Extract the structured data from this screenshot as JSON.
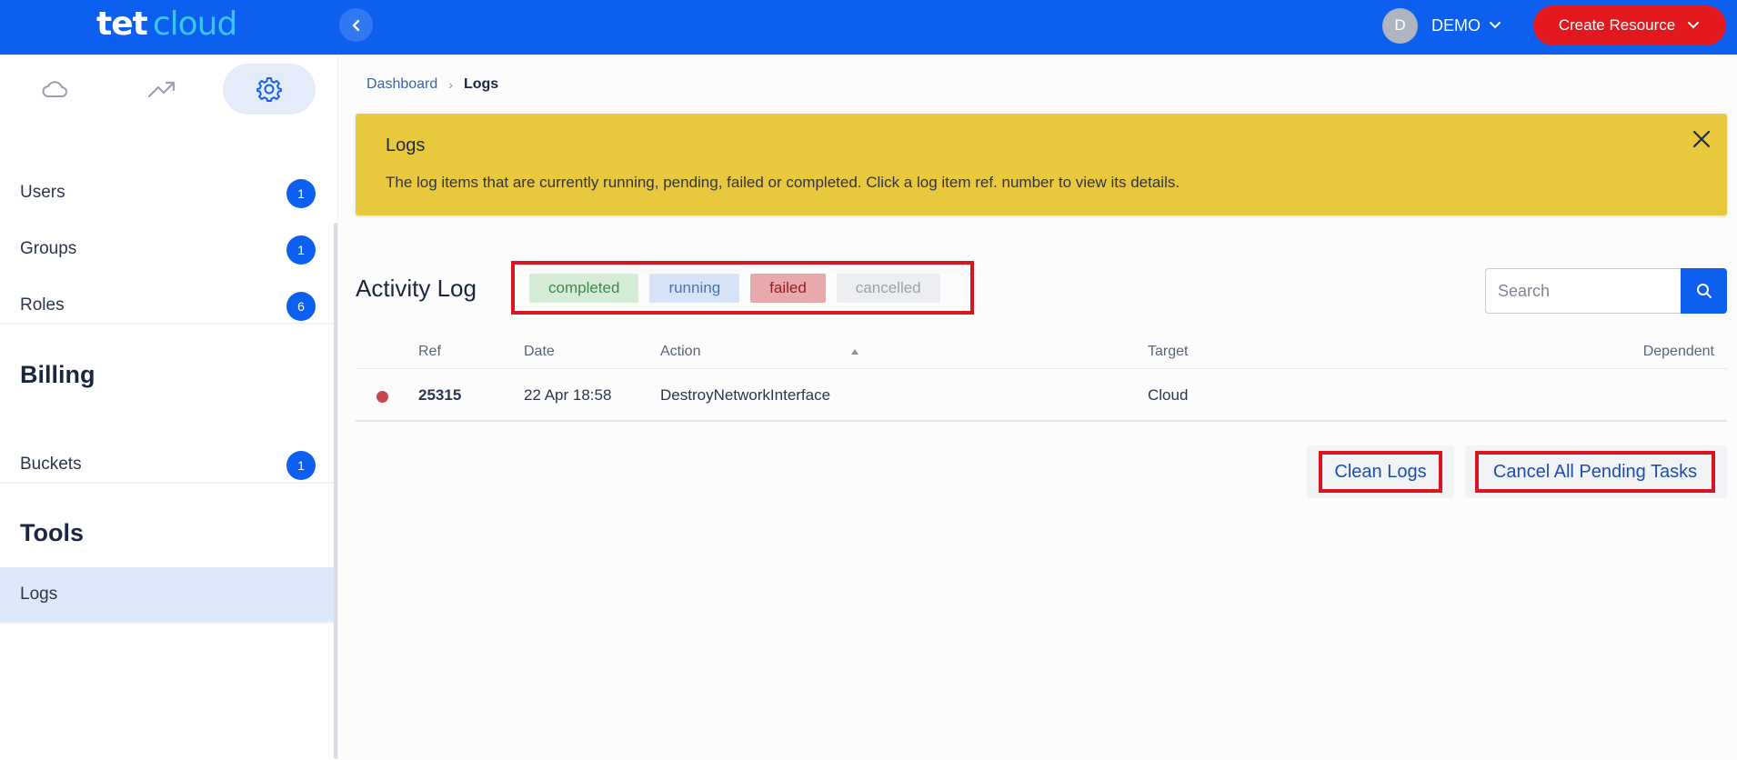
{
  "brand": {
    "part1": "tet",
    "part2": "cloud"
  },
  "header": {
    "user": {
      "initial": "D",
      "name": "DEMO"
    },
    "create_label": "Create Resource"
  },
  "sidebar": {
    "tabs": [
      {
        "icon": "cloud-icon",
        "active": false
      },
      {
        "icon": "trending-up-icon",
        "active": false
      },
      {
        "icon": "gear-icon",
        "active": true
      }
    ],
    "items": [
      {
        "label": "Users",
        "count": "1"
      },
      {
        "label": "Groups",
        "count": "1"
      },
      {
        "label": "Roles",
        "count": "6"
      }
    ],
    "billing": {
      "title": "Billing",
      "items": [
        {
          "label": "Buckets",
          "count": "1"
        }
      ]
    },
    "tools": {
      "title": "Tools",
      "items": [
        {
          "label": "Logs",
          "active": true
        }
      ]
    }
  },
  "breadcrumb": {
    "root": "Dashboard",
    "current": "Logs"
  },
  "banner": {
    "title": "Logs",
    "description": "The log items that are currently running, pending, failed or completed. Click a log item ref. number to view its details."
  },
  "activity": {
    "title": "Activity Log",
    "filters": [
      {
        "label": "completed",
        "bg": "#d5ecd7",
        "color": "#3d8c44"
      },
      {
        "label": "running",
        "bg": "#d7e4f7",
        "color": "#4a73b6"
      },
      {
        "label": "failed",
        "bg": "#e7a9ac",
        "color": "#9d1c24"
      },
      {
        "label": "cancelled",
        "bg": "#eceef1",
        "color": "#9aa1ad"
      }
    ],
    "search_placeholder": "Search"
  },
  "table": {
    "columns": [
      "Ref",
      "Date",
      "Action",
      "Target",
      "Dependent"
    ],
    "rows": [
      {
        "status": "failed",
        "ref": "25315",
        "date": "22 Apr 18:58",
        "action": "DestroyNetworkInterface",
        "target": "Cloud",
        "dependent": ""
      }
    ]
  },
  "actions": {
    "clean": "Clean Logs",
    "cancel_all": "Cancel All Pending Tasks"
  },
  "colors": {
    "primary": "#0d5ff0",
    "danger": "#e3181f",
    "banner": "#e8c93e",
    "failed_dot": "#c8494d"
  }
}
